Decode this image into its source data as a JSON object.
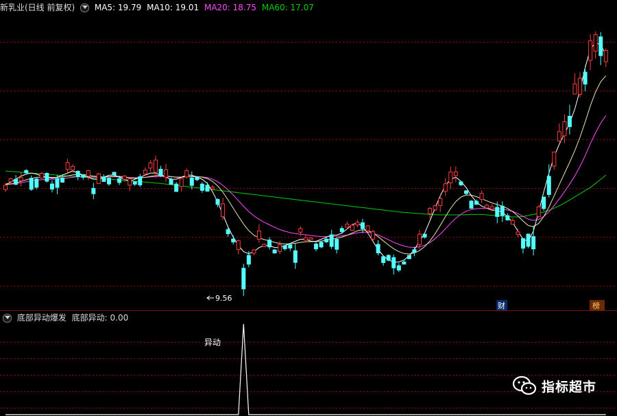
{
  "header": {
    "title": "新乳业(日线 前复权)",
    "ma5": "MA5: 19.79",
    "ma10": "MA10: 19.01",
    "ma20": "MA20: 18.75",
    "ma60": "MA60: 17.07"
  },
  "sub_header": {
    "indicator_name": "底部异动爆发",
    "value_label": "底部异动: 0.00"
  },
  "annotations": {
    "low_price": "9.56",
    "signal_label": "异动",
    "marker_cai": "财",
    "marker_bang": "榜"
  },
  "brand": {
    "name": "指标超市",
    "icon": "wechat-icon"
  },
  "colors": {
    "background": "#000000",
    "up": "#ff3c3c",
    "down": "#54ffff",
    "ma5": "#ffffff",
    "ma10": "#ffff00",
    "ma20": "#ff4cff",
    "ma60": "#00d000",
    "grid": "#8b0000",
    "signal": "#ffffff"
  },
  "chart_data": [
    {
      "type": "candlestick",
      "title": "新乳业(日线 前复权)",
      "ylim": [
        9.0,
        23.2
      ],
      "series": [
        {
          "name": "MA5",
          "values": [
            14.95,
            15.05,
            15.2,
            15.35,
            15.45,
            15.5,
            15.45,
            15.35,
            15.3,
            15.25,
            15.3,
            15.4,
            15.5,
            15.6,
            15.5,
            15.4,
            15.3,
            15.2,
            15.2,
            15.3,
            15.4,
            15.4,
            15.3,
            15.2,
            15.1,
            15.2,
            15.3,
            15.4,
            15.5,
            15.5,
            15.4,
            15.3,
            15.2,
            15.2,
            15.3,
            15.4,
            15.4,
            15.3,
            15.2,
            15.0,
            14.6,
            14.1,
            13.5,
            12.9,
            12.4,
            12.0,
            11.7,
            11.6,
            11.7,
            11.9,
            12.0,
            12.0,
            11.9,
            11.9,
            12.0,
            12.1,
            12.2,
            12.3,
            12.3,
            12.2,
            12.2,
            12.3,
            12.4,
            12.5,
            12.5,
            12.6,
            12.8,
            13.0,
            13.1,
            12.9,
            12.6,
            12.2,
            11.8,
            11.5,
            11.3,
            11.2,
            11.2,
            11.3,
            11.5,
            11.8,
            12.2,
            12.6,
            13.2,
            13.8,
            14.4,
            14.9,
            15.2,
            15.3,
            15.1,
            14.8,
            14.4,
            14.1,
            13.9,
            13.8,
            13.7,
            13.7,
            13.6,
            13.4,
            13.1,
            12.7,
            12.3,
            12.2,
            12.7,
            13.6,
            14.6,
            15.5,
            16.3,
            16.9,
            17.4,
            17.9,
            18.6,
            19.5,
            20.6,
            21.5,
            21.8,
            21.7,
            21.2
          ]
        },
        {
          "name": "MA60",
          "values": [
            15.6,
            15.58,
            15.56,
            15.54,
            15.52,
            15.5,
            15.48,
            15.46,
            15.44,
            15.42,
            15.4,
            15.38,
            15.36,
            15.34,
            15.32,
            15.3,
            15.28,
            15.26,
            15.24,
            15.22,
            15.2,
            15.18,
            15.16,
            15.14,
            15.12,
            15.1,
            15.08,
            15.06,
            15.04,
            15.02,
            15.0,
            14.97,
            14.94,
            14.91,
            14.88,
            14.85,
            14.82,
            14.79,
            14.76,
            14.73,
            14.7,
            14.67,
            14.64,
            14.61,
            14.58,
            14.55,
            14.52,
            14.49,
            14.46,
            14.43,
            14.4,
            14.37,
            14.34,
            14.31,
            14.28,
            14.25,
            14.22,
            14.19,
            14.16,
            14.13,
            14.1,
            14.07,
            14.04,
            14.01,
            13.98,
            13.95,
            13.92,
            13.89,
            13.86,
            13.83,
            13.8,
            13.77,
            13.74,
            13.71,
            13.68,
            13.65,
            13.62,
            13.6,
            13.58,
            13.56,
            13.54,
            13.52,
            13.5,
            13.49,
            13.48,
            13.48,
            13.48,
            13.48,
            13.48,
            13.49,
            13.5,
            13.5,
            13.5,
            13.48,
            13.46,
            13.44,
            13.42,
            13.4,
            13.38,
            13.38,
            13.4,
            13.45,
            13.5,
            13.55,
            13.62,
            13.7,
            13.8,
            13.92,
            14.05,
            14.2,
            14.35,
            14.5,
            14.65,
            14.8,
            15.0,
            15.2,
            15.4
          ]
        }
      ]
    },
    {
      "type": "line",
      "title": "底部异动爆发",
      "series": [
        {
          "name": "底部异动",
          "values": [
            0,
            0,
            0,
            0,
            0,
            0,
            0,
            0,
            0,
            0,
            0,
            0,
            0,
            0,
            0,
            0,
            0,
            0,
            0,
            0,
            0,
            0,
            0,
            0,
            0,
            0,
            0,
            0,
            0,
            0,
            0,
            0,
            0,
            0,
            0,
            0,
            0,
            0,
            0,
            0,
            0,
            0,
            0,
            0,
            0,
            0,
            1,
            0,
            0,
            0,
            0,
            0,
            0,
            0,
            0,
            0,
            0,
            0,
            0,
            0,
            0,
            0,
            0,
            0,
            0,
            0,
            0,
            0,
            0,
            0,
            0,
            0,
            0,
            0,
            0,
            0,
            0,
            0,
            0,
            0,
            0,
            0,
            0,
            0,
            0,
            0,
            0,
            0,
            0,
            0,
            0,
            0,
            0,
            0,
            0,
            0,
            0,
            0,
            0,
            0,
            0,
            0,
            0,
            0,
            0,
            0,
            0,
            0,
            0,
            0,
            0,
            0,
            0,
            0,
            0,
            0,
            0
          ]
        }
      ]
    }
  ]
}
